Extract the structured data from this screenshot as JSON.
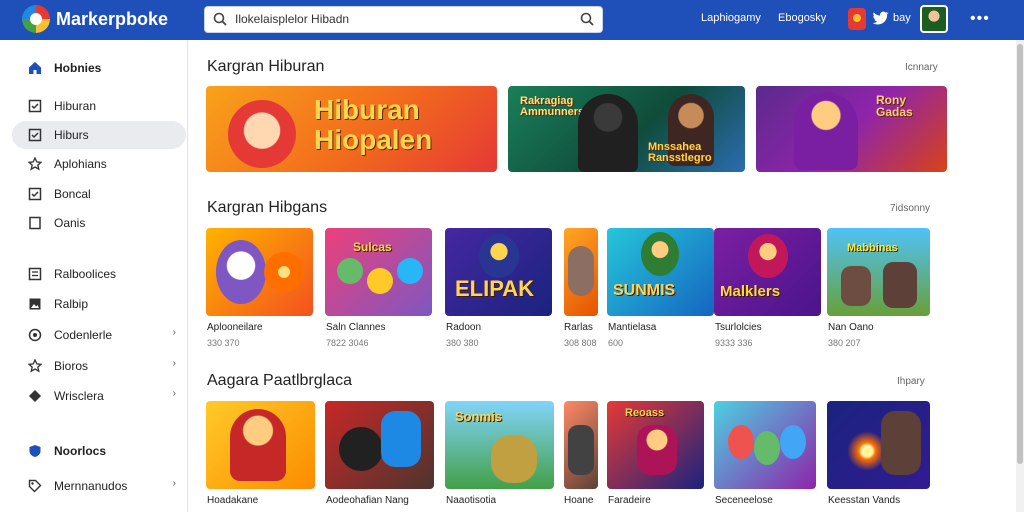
{
  "header": {
    "brand": "Markerpboke",
    "search_value": "Ilokelaisplelor Hibadn",
    "nav_links": [
      "Laphiogamy",
      "Ebogosky"
    ],
    "user_label": "bay",
    "more_label": "•••"
  },
  "sidebar": {
    "items": [
      {
        "label": "Hobnies",
        "icon": "home-icon",
        "bold": true
      },
      {
        "label": "Hiburan",
        "icon": "check-box-icon"
      },
      {
        "label": "Hiburs",
        "icon": "check-box-icon",
        "active": true
      },
      {
        "label": "Aplohians",
        "icon": "star-icon"
      },
      {
        "label": "Boncal",
        "icon": "check-box-icon"
      },
      {
        "label": "Oanis",
        "icon": "square-icon"
      },
      {
        "label": "Ralboolices",
        "icon": "list-icon"
      },
      {
        "label": "Ralbip",
        "icon": "image-icon"
      },
      {
        "label": "Codenlerle",
        "icon": "circle-icon",
        "chevron": "›"
      },
      {
        "label": "Bioros",
        "icon": "star-icon",
        "chevron": "›"
      },
      {
        "label": "Wrisclera",
        "icon": "diamond-icon",
        "chevron": "›"
      },
      {
        "label": "Noorlocs",
        "icon": "shield-icon",
        "bold": true
      },
      {
        "label": "Mernnanudos",
        "icon": "tag-icon",
        "chevron": "›"
      }
    ]
  },
  "sections": [
    {
      "title": "Kargran Hiburan",
      "more": "Icnnary"
    },
    {
      "title": "Kargran Hibgans",
      "more": "7idsonny"
    },
    {
      "title": "Aagara Paatlbrglaca",
      "more": "Ihpary"
    }
  ],
  "banners": [
    {
      "text_line1": "Hiburan",
      "text_line2": "Hiopalen"
    },
    {
      "text_left": "Rakragiag\nAmmunnerse",
      "text_right": "Mnssahea\nRansstlegro"
    },
    {
      "text": "Rony\nGadas"
    }
  ],
  "row2": [
    {
      "name": "Aplooneilare",
      "sub": "330 370",
      "art": ""
    },
    {
      "name": "Saln Clannes",
      "sub": "7822 3046",
      "art": "Sulcas"
    },
    {
      "name": "Radoon",
      "sub": "380 380",
      "art": "ELIPAK"
    },
    {
      "name": "Rarlas",
      "sub": "308 808",
      "art": ""
    },
    {
      "name": "Mantielasa",
      "sub": "600",
      "art": "SUNMIS"
    },
    {
      "name": "Tsurlolcies",
      "sub": "9333 336",
      "art": "Malklers"
    },
    {
      "name": "Nan Oano",
      "sub": "380 207",
      "art": "Mabbinas"
    }
  ],
  "row3": [
    {
      "name": "Hoadakane",
      "art": ""
    },
    {
      "name": "Aodeohafian Nang",
      "art": ""
    },
    {
      "name": "Naaotisotia",
      "art": "Sonmis"
    },
    {
      "name": "Hoane",
      "art": ""
    },
    {
      "name": "Faradeire",
      "art": "Reoass"
    },
    {
      "name": "Seceneelose",
      "art": ""
    },
    {
      "name": "Keesstan Vands",
      "art": ""
    }
  ],
  "colors": {
    "topbar": "#1f4fb8",
    "sidebar_active": "#e9ebef"
  }
}
